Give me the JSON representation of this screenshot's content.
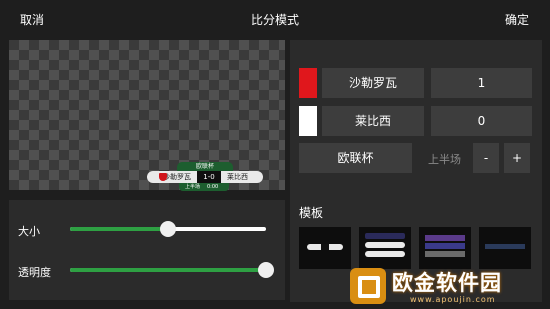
{
  "topbar": {
    "cancel": "取消",
    "title": "比分模式",
    "confirm": "确定"
  },
  "preview": {
    "competition": "欧联杯",
    "home": "沙勒罗瓦",
    "score": "1-0",
    "away": "莱比西",
    "half": "上半场",
    "time": "0:00"
  },
  "sliders": {
    "size": {
      "label": "大小",
      "value_percent": 50
    },
    "opacity": {
      "label": "透明度",
      "value_percent": 100
    }
  },
  "teams": [
    {
      "name": "沙勒罗瓦",
      "score": "1",
      "color": "#e0171c"
    },
    {
      "name": "莱比西",
      "score": "0",
      "color": "#ffffff"
    }
  ],
  "competition_field": {
    "value": "欧联杯"
  },
  "period": {
    "label": "上半场",
    "minus": "-",
    "plus": "+"
  },
  "templates": {
    "title": "模板",
    "count": 4
  },
  "watermark": {
    "text": "欧金软件园",
    "url": "www.apoujin.com"
  },
  "colors": {
    "accent": "#2ea043",
    "panel": "#2b2b2b",
    "field": "#3d3d3d"
  }
}
